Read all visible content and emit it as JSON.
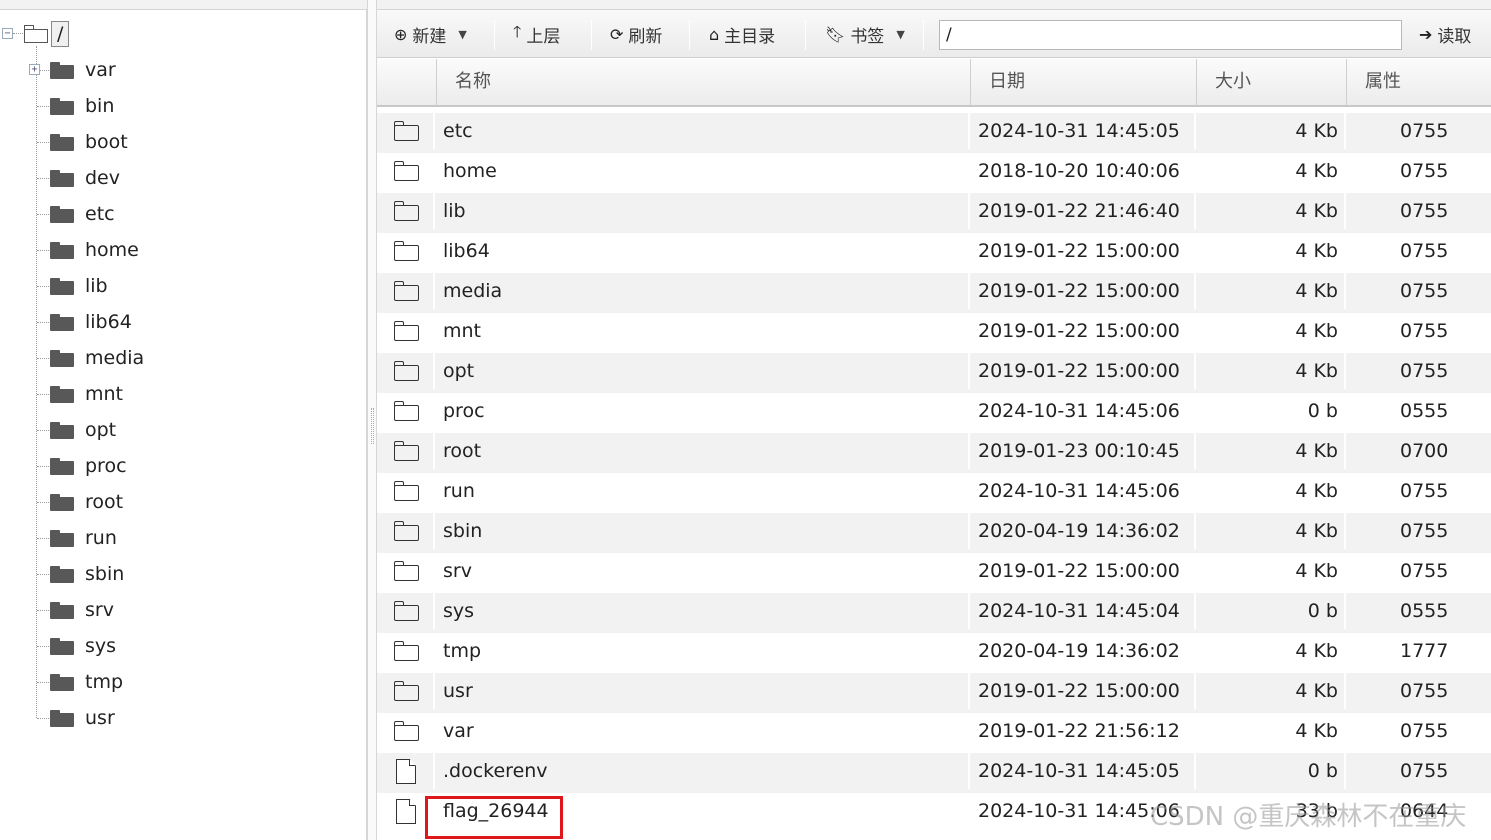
{
  "tree": {
    "root_label": "/",
    "root_toggle": "−",
    "var_toggle": "+",
    "items": [
      {
        "label": "var"
      },
      {
        "label": "bin"
      },
      {
        "label": "boot"
      },
      {
        "label": "dev"
      },
      {
        "label": "etc"
      },
      {
        "label": "home"
      },
      {
        "label": "lib"
      },
      {
        "label": "lib64"
      },
      {
        "label": "media"
      },
      {
        "label": "mnt"
      },
      {
        "label": "opt"
      },
      {
        "label": "proc"
      },
      {
        "label": "root"
      },
      {
        "label": "run"
      },
      {
        "label": "sbin"
      },
      {
        "label": "srv"
      },
      {
        "label": "sys"
      },
      {
        "label": "tmp"
      },
      {
        "label": "usr"
      }
    ]
  },
  "toolbar": {
    "new_label": "新建",
    "up_label": "上层",
    "refresh_label": "刷新",
    "home_label": "主目录",
    "bookmark_label": "书签",
    "path_value": "/",
    "read_label": "读取"
  },
  "icons": {
    "new": "plus-circle-icon",
    "up": "arrow-up-icon",
    "refresh": "refresh-icon",
    "home": "home-icon",
    "bookmark": "bookmark-icon",
    "read": "arrow-right-icon"
  },
  "columns": {
    "name": "名称",
    "date": "日期",
    "size": "大小",
    "attr": "属性"
  },
  "rows": [
    {
      "type": "folder",
      "name": "etc",
      "date": "2024-10-31 14:45:05",
      "size": "4 Kb",
      "attr": "0755"
    },
    {
      "type": "folder",
      "name": "home",
      "date": "2018-10-20 10:40:06",
      "size": "4 Kb",
      "attr": "0755"
    },
    {
      "type": "folder",
      "name": "lib",
      "date": "2019-01-22 21:46:40",
      "size": "4 Kb",
      "attr": "0755"
    },
    {
      "type": "folder",
      "name": "lib64",
      "date": "2019-01-22 15:00:00",
      "size": "4 Kb",
      "attr": "0755"
    },
    {
      "type": "folder",
      "name": "media",
      "date": "2019-01-22 15:00:00",
      "size": "4 Kb",
      "attr": "0755"
    },
    {
      "type": "folder",
      "name": "mnt",
      "date": "2019-01-22 15:00:00",
      "size": "4 Kb",
      "attr": "0755"
    },
    {
      "type": "folder",
      "name": "opt",
      "date": "2019-01-22 15:00:00",
      "size": "4 Kb",
      "attr": "0755"
    },
    {
      "type": "folder",
      "name": "proc",
      "date": "2024-10-31 14:45:06",
      "size": "0 b",
      "attr": "0555"
    },
    {
      "type": "folder",
      "name": "root",
      "date": "2019-01-23 00:10:45",
      "size": "4 Kb",
      "attr": "0700"
    },
    {
      "type": "folder",
      "name": "run",
      "date": "2024-10-31 14:45:06",
      "size": "4 Kb",
      "attr": "0755"
    },
    {
      "type": "folder",
      "name": "sbin",
      "date": "2020-04-19 14:36:02",
      "size": "4 Kb",
      "attr": "0755"
    },
    {
      "type": "folder",
      "name": "srv",
      "date": "2019-01-22 15:00:00",
      "size": "4 Kb",
      "attr": "0755"
    },
    {
      "type": "folder",
      "name": "sys",
      "date": "2024-10-31 14:45:04",
      "size": "0 b",
      "attr": "0555"
    },
    {
      "type": "folder",
      "name": "tmp",
      "date": "2020-04-19 14:36:02",
      "size": "4 Kb",
      "attr": "1777"
    },
    {
      "type": "folder",
      "name": "usr",
      "date": "2019-01-22 15:00:00",
      "size": "4 Kb",
      "attr": "0755"
    },
    {
      "type": "folder",
      "name": "var",
      "date": "2019-01-22 21:56:12",
      "size": "4 Kb",
      "attr": "0755"
    },
    {
      "type": "file",
      "name": ".dockerenv",
      "date": "2024-10-31 14:45:05",
      "size": "0 b",
      "attr": "0755"
    },
    {
      "type": "file",
      "name": "flag_26944",
      "date": "2024-10-31 14:45:06",
      "size": "33 b",
      "attr": "0644"
    }
  ],
  "highlight_color": "#e0161b",
  "watermark": "CSDN @重庆森林不在重庆"
}
